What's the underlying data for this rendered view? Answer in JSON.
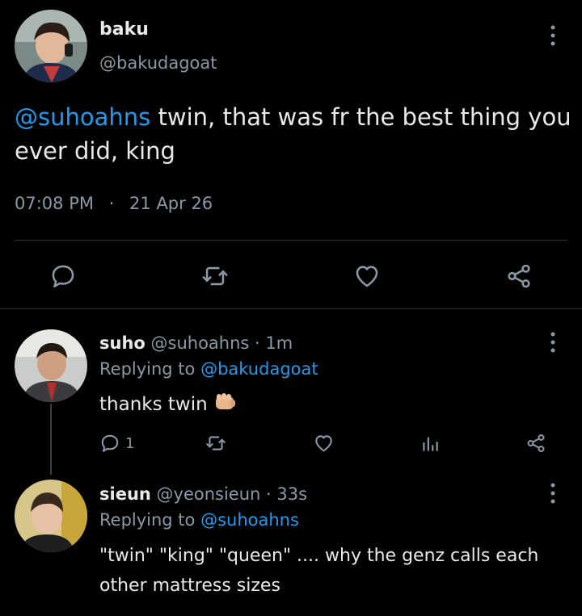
{
  "main_tweet": {
    "display_name": "baku",
    "handle": "@bakudagoat",
    "mention": "@suhoahns",
    "text": " twin, that was fr the best thing you ever did, king",
    "time": "07:08 PM",
    "separator": "·",
    "date": "21 Apr 26"
  },
  "replies": [
    {
      "display_name": "suho",
      "handle": "@suhoahns",
      "age": "· 1m",
      "replying_label": "Replying to",
      "replying_to": "@bakudagoat",
      "text": "thanks twin",
      "emoji": "fist-bump",
      "reply_count": "1"
    },
    {
      "display_name": "sieun",
      "handle": "@yeonsieun",
      "age": "· 33s",
      "replying_label": "Replying to",
      "replying_to": "@suhoahns",
      "text": "\"twin\" \"king\" \"queen\" .... why the genz calls each other mattress sizes"
    }
  ],
  "colors": {
    "background": "#000000",
    "text": "#e7e9ea",
    "muted": "#8b98a5",
    "link": "#1d9bf0",
    "divider": "#2f3336"
  }
}
